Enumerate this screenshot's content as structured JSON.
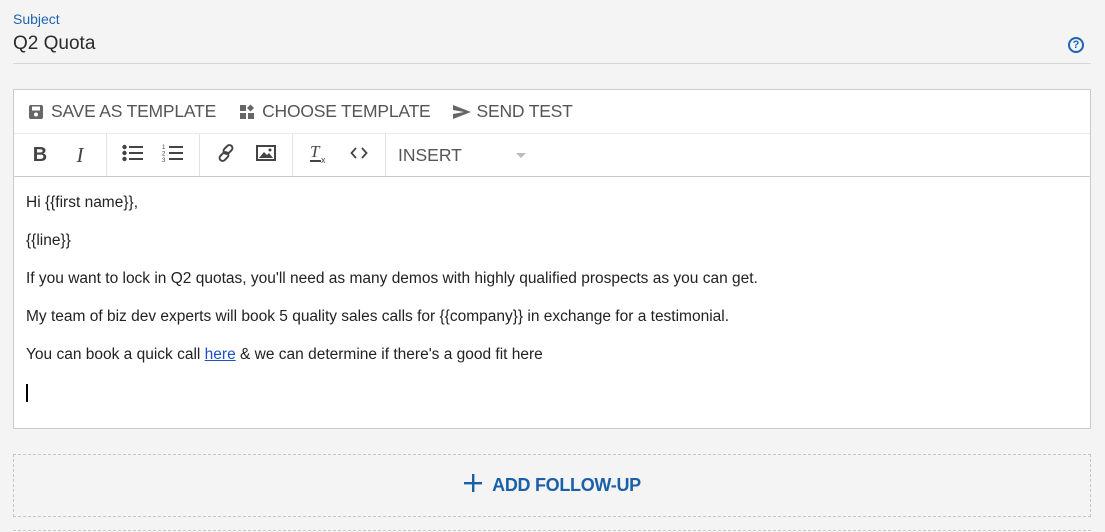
{
  "subject": {
    "label": "Subject",
    "value": "Q2 Quota",
    "help_icon": "question-circle-icon"
  },
  "template_toolbar": {
    "items": [
      {
        "label": "SAVE AS TEMPLATE",
        "icon": "floppy-disk-icon"
      },
      {
        "label": "CHOOSE TEMPLATE",
        "icon": "template-grid-icon"
      },
      {
        "label": "SEND TEST",
        "icon": "send-icon"
      }
    ]
  },
  "format_toolbar": {
    "bold": "B",
    "italic": "I",
    "insert_label": "INSERT",
    "icons": [
      "bold-icon",
      "italic-icon",
      "bullet-list-icon",
      "numbered-list-icon",
      "link-icon",
      "image-icon",
      "clear-format-icon",
      "code-icon"
    ]
  },
  "body": {
    "greeting": "Hi {{first name}},",
    "line": "{{line}}",
    "para1": "If you want to lock in Q2 quotas, you'll need as many demos with highly qualified prospects as you can get.",
    "para2": "My team of biz dev experts will book 5 quality sales calls for {{company}} in exchange for a testimonial.",
    "para3_before": "You can book a quick call ",
    "para3_link": "here",
    "para3_after": " & we can determine if there's a good fit here"
  },
  "followup": {
    "label": "ADD FOLLOW-UP",
    "icon": "plus-icon"
  },
  "colors": {
    "accent": "#1b65b0",
    "link": "#1a52c6",
    "background": "#f4f4f4"
  }
}
